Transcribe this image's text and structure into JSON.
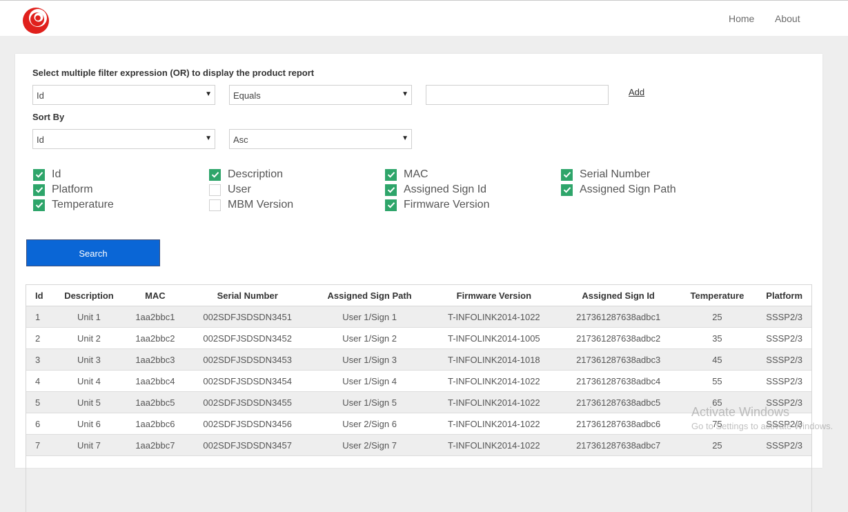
{
  "nav": {
    "home": "Home",
    "about": "About"
  },
  "filter": {
    "heading": "Select multiple filter expression (OR) to display the product report",
    "field": "Id",
    "operator": "Equals",
    "value": "",
    "add_label": "Add"
  },
  "sort": {
    "heading": "Sort By",
    "field": "Id",
    "direction": "Asc"
  },
  "columns_options": [
    {
      "label": "Id",
      "checked": true
    },
    {
      "label": "Platform",
      "checked": true
    },
    {
      "label": "Temperature",
      "checked": true
    },
    {
      "label": "Description",
      "checked": true
    },
    {
      "label": "User",
      "checked": false
    },
    {
      "label": "MBM Version",
      "checked": false
    },
    {
      "label": "MAC",
      "checked": true
    },
    {
      "label": "Assigned Sign Id",
      "checked": true
    },
    {
      "label": "Firmware Version",
      "checked": true
    },
    {
      "label": "Serial Number",
      "checked": true
    },
    {
      "label": "Assigned Sign Path",
      "checked": true
    }
  ],
  "search_label": "Search",
  "table": {
    "headers": [
      "Id",
      "Description",
      "MAC",
      "Serial Number",
      "Assigned Sign Path",
      "Firmware Version",
      "Assigned Sign Id",
      "Temperature",
      "Platform"
    ],
    "rows": [
      [
        "1",
        "Unit 1",
        "1aa2bbc1",
        "002SDFJSDSDN3451",
        "User 1/Sign 1",
        "T-INFOLINK2014-1022",
        "217361287638adbc1",
        "25",
        "SSSP2/3"
      ],
      [
        "2",
        "Unit 2",
        "1aa2bbc2",
        "002SDFJSDSDN3452",
        "User 1/Sign 2",
        "T-INFOLINK2014-1005",
        "217361287638adbc2",
        "35",
        "SSSP2/3"
      ],
      [
        "3",
        "Unit 3",
        "1aa2bbc3",
        "002SDFJSDSDN3453",
        "User 1/Sign 3",
        "T-INFOLINK2014-1018",
        "217361287638adbc3",
        "45",
        "SSSP2/3"
      ],
      [
        "4",
        "Unit 4",
        "1aa2bbc4",
        "002SDFJSDSDN3454",
        "User 1/Sign 4",
        "T-INFOLINK2014-1022",
        "217361287638adbc4",
        "55",
        "SSSP2/3"
      ],
      [
        "5",
        "Unit 5",
        "1aa2bbc5",
        "002SDFJSDSDN3455",
        "User 1/Sign 5",
        "T-INFOLINK2014-1022",
        "217361287638adbc5",
        "65",
        "SSSP2/3"
      ],
      [
        "6",
        "Unit 6",
        "1aa2bbc6",
        "002SDFJSDSDN3456",
        "User 2/Sign 6",
        "T-INFOLINK2014-1022",
        "217361287638adbc6",
        "75",
        "SSSP2/3"
      ],
      [
        "7",
        "Unit 7",
        "1aa2bbc7",
        "002SDFJSDSDN3457",
        "User 2/Sign 7",
        "T-INFOLINK2014-1022",
        "217361287638adbc7",
        "25",
        "SSSP2/3"
      ]
    ]
  },
  "watermark": {
    "title": "Activate Windows",
    "subtitle": "Go to Settings to activate Windows."
  },
  "colors": {
    "accent_blue": "#0a66d6",
    "check_green": "#2ea56a",
    "logo_red": "#e0201c"
  }
}
